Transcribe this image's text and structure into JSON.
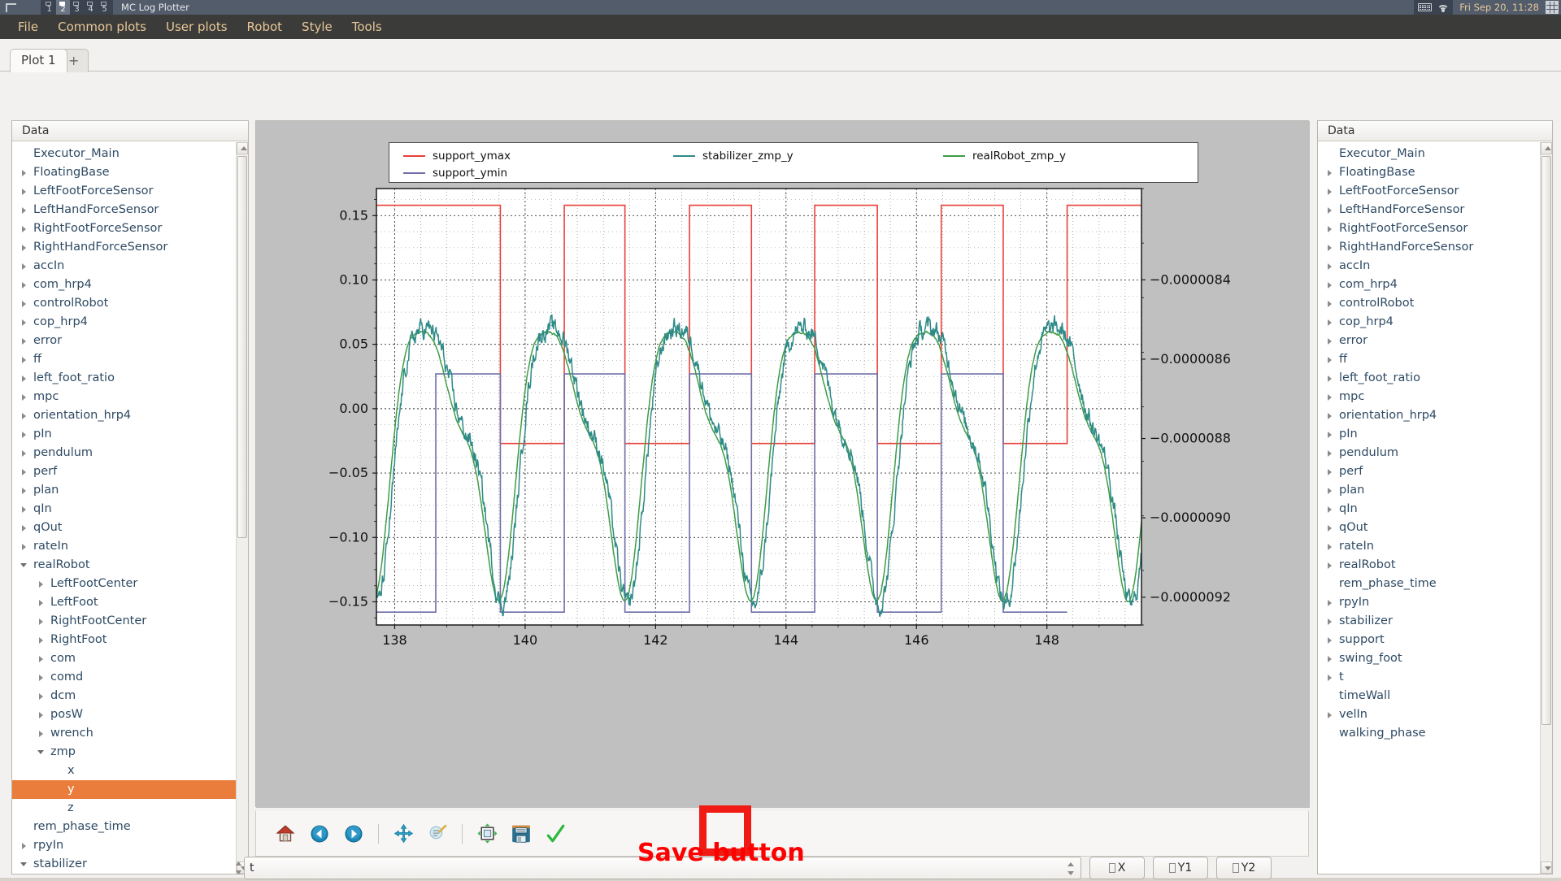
{
  "desktop": {
    "title": "MC Log Plotter",
    "workspaces": [
      "1",
      "2",
      "3",
      "4",
      "5"
    ],
    "active_workspace": "2",
    "clock": "Fri Sep 20, 11:28",
    "tray_icons": [
      "keyboard-icon",
      "wifi-icon",
      "grid-icon"
    ]
  },
  "menubar": {
    "items": [
      "File",
      "Common plots",
      "User plots",
      "Robot",
      "Style",
      "Tools"
    ]
  },
  "tabs": {
    "items": [
      {
        "label": "Plot 1",
        "selected": true
      },
      {
        "label": "+",
        "selected": false
      }
    ]
  },
  "left_panel": {
    "header": "Data",
    "items": [
      {
        "label": "Executor_Main",
        "depth": 0,
        "state": "leaf"
      },
      {
        "label": "FloatingBase",
        "depth": 0,
        "state": "closed"
      },
      {
        "label": "LeftFootForceSensor",
        "depth": 0,
        "state": "closed"
      },
      {
        "label": "LeftHandForceSensor",
        "depth": 0,
        "state": "closed"
      },
      {
        "label": "RightFootForceSensor",
        "depth": 0,
        "state": "closed"
      },
      {
        "label": "RightHandForceSensor",
        "depth": 0,
        "state": "closed"
      },
      {
        "label": "accIn",
        "depth": 0,
        "state": "closed"
      },
      {
        "label": "com_hrp4",
        "depth": 0,
        "state": "closed"
      },
      {
        "label": "controlRobot",
        "depth": 0,
        "state": "closed"
      },
      {
        "label": "cop_hrp4",
        "depth": 0,
        "state": "closed"
      },
      {
        "label": "error",
        "depth": 0,
        "state": "closed"
      },
      {
        "label": "ff",
        "depth": 0,
        "state": "closed"
      },
      {
        "label": "left_foot_ratio",
        "depth": 0,
        "state": "closed"
      },
      {
        "label": "mpc",
        "depth": 0,
        "state": "closed"
      },
      {
        "label": "orientation_hrp4",
        "depth": 0,
        "state": "closed"
      },
      {
        "label": "pIn",
        "depth": 0,
        "state": "closed"
      },
      {
        "label": "pendulum",
        "depth": 0,
        "state": "closed"
      },
      {
        "label": "perf",
        "depth": 0,
        "state": "closed"
      },
      {
        "label": "plan",
        "depth": 0,
        "state": "closed"
      },
      {
        "label": "qIn",
        "depth": 0,
        "state": "closed"
      },
      {
        "label": "qOut",
        "depth": 0,
        "state": "closed"
      },
      {
        "label": "rateIn",
        "depth": 0,
        "state": "closed"
      },
      {
        "label": "realRobot",
        "depth": 0,
        "state": "open"
      },
      {
        "label": "LeftFootCenter",
        "depth": 1,
        "state": "closed"
      },
      {
        "label": "LeftFoot",
        "depth": 1,
        "state": "closed"
      },
      {
        "label": "RightFootCenter",
        "depth": 1,
        "state": "closed"
      },
      {
        "label": "RightFoot",
        "depth": 1,
        "state": "closed"
      },
      {
        "label": "com",
        "depth": 1,
        "state": "closed"
      },
      {
        "label": "comd",
        "depth": 1,
        "state": "closed"
      },
      {
        "label": "dcm",
        "depth": 1,
        "state": "closed"
      },
      {
        "label": "posW",
        "depth": 1,
        "state": "closed"
      },
      {
        "label": "wrench",
        "depth": 1,
        "state": "closed"
      },
      {
        "label": "zmp",
        "depth": 1,
        "state": "open"
      },
      {
        "label": "x",
        "depth": 2,
        "state": "leaf"
      },
      {
        "label": "y",
        "depth": 2,
        "state": "leaf",
        "selected": true
      },
      {
        "label": "z",
        "depth": 2,
        "state": "leaf"
      },
      {
        "label": "rem_phase_time",
        "depth": 0,
        "state": "leaf"
      },
      {
        "label": "rpyIn",
        "depth": 0,
        "state": "closed"
      },
      {
        "label": "stabilizer",
        "depth": 0,
        "state": "open"
      }
    ],
    "selection_color": "#ea7d3c"
  },
  "right_panel": {
    "header": "Data",
    "items": [
      {
        "label": "Executor_Main",
        "state": "leaf"
      },
      {
        "label": "FloatingBase",
        "state": "closed"
      },
      {
        "label": "LeftFootForceSensor",
        "state": "closed"
      },
      {
        "label": "LeftHandForceSensor",
        "state": "closed"
      },
      {
        "label": "RightFootForceSensor",
        "state": "closed"
      },
      {
        "label": "RightHandForceSensor",
        "state": "closed"
      },
      {
        "label": "accIn",
        "state": "closed"
      },
      {
        "label": "com_hrp4",
        "state": "closed"
      },
      {
        "label": "controlRobot",
        "state": "closed"
      },
      {
        "label": "cop_hrp4",
        "state": "closed"
      },
      {
        "label": "error",
        "state": "closed"
      },
      {
        "label": "ff",
        "state": "closed"
      },
      {
        "label": "left_foot_ratio",
        "state": "closed"
      },
      {
        "label": "mpc",
        "state": "closed"
      },
      {
        "label": "orientation_hrp4",
        "state": "closed"
      },
      {
        "label": "pIn",
        "state": "closed"
      },
      {
        "label": "pendulum",
        "state": "closed"
      },
      {
        "label": "perf",
        "state": "closed"
      },
      {
        "label": "plan",
        "state": "closed"
      },
      {
        "label": "qIn",
        "state": "closed"
      },
      {
        "label": "qOut",
        "state": "closed"
      },
      {
        "label": "rateIn",
        "state": "closed"
      },
      {
        "label": "realRobot",
        "state": "closed"
      },
      {
        "label": "rem_phase_time",
        "state": "leaf"
      },
      {
        "label": "rpyIn",
        "state": "closed"
      },
      {
        "label": "stabilizer",
        "state": "closed"
      },
      {
        "label": "support",
        "state": "closed"
      },
      {
        "label": "swing_foot",
        "state": "closed"
      },
      {
        "label": "t",
        "state": "closed"
      },
      {
        "label": "timeWall",
        "state": "leaf"
      },
      {
        "label": "velIn",
        "state": "closed"
      },
      {
        "label": "walking_phase",
        "state": "leaf"
      }
    ]
  },
  "toolbar": {
    "buttons": [
      {
        "name": "home-icon",
        "tip": "Home"
      },
      {
        "name": "back-arrow-icon",
        "tip": "Back"
      },
      {
        "name": "forward-arrow-icon",
        "tip": "Forward"
      },
      {
        "name": "pan-move-icon",
        "tip": "Pan"
      },
      {
        "name": "zoom-rect-icon",
        "tip": "Zoom to rectangle"
      },
      {
        "name": "configure-subplots-icon",
        "tip": "Configure subplots"
      },
      {
        "name": "save-figure-icon",
        "tip": "Save the figure"
      },
      {
        "name": "checkmark-icon",
        "tip": "Apply"
      }
    ]
  },
  "annotation": {
    "text": "Save button",
    "color": "#ff0000",
    "highlight_color": "#ef1b14"
  },
  "bottombar": {
    "expression_value": "t",
    "buttons": [
      {
        "label": "X",
        "glyph": "tofu"
      },
      {
        "label": "Y1",
        "glyph": "tofu"
      },
      {
        "label": "Y2",
        "glyph": "tofu"
      }
    ]
  },
  "chart_data": {
    "type": "line",
    "title": "",
    "xlabel": "",
    "ylabel": "",
    "xlim": [
      137.72,
      149.45
    ],
    "ylim": [
      -0.168,
      0.171
    ],
    "y2lim": [
      -9.27e-06,
      -8.17e-06
    ],
    "xticks": [
      138,
      140,
      142,
      144,
      146,
      148
    ],
    "yticks": [
      0.15,
      0.1,
      0.05,
      0.0,
      -0.05,
      -0.1,
      -0.15
    ],
    "y2ticks": [
      -8.4e-06,
      -8.6e-06,
      -8.8e-06,
      -9e-06,
      -9.2e-06
    ],
    "grid": true,
    "grid_style": "dotted",
    "legend_position": "upper center (outside axes)",
    "legend_ncol": 3,
    "series": [
      {
        "name": "support_ymax",
        "color": "#e8403a",
        "style": "square-wave",
        "high": 0.158,
        "low": -0.027,
        "segments": [
          {
            "x0": 137.72,
            "x1": 139.62,
            "y": 0.158
          },
          {
            "x0": 139.62,
            "x1": 140.6,
            "y": -0.027
          },
          {
            "x0": 140.6,
            "x1": 141.53,
            "y": 0.158
          },
          {
            "x0": 141.53,
            "x1": 142.52,
            "y": -0.027
          },
          {
            "x0": 142.52,
            "x1": 143.47,
            "y": 0.158
          },
          {
            "x0": 143.47,
            "x1": 144.44,
            "y": -0.027
          },
          {
            "x0": 144.44,
            "x1": 145.4,
            "y": 0.158
          },
          {
            "x0": 145.4,
            "x1": 146.38,
            "y": -0.027
          },
          {
            "x0": 146.38,
            "x1": 147.33,
            "y": 0.158
          },
          {
            "x0": 147.33,
            "x1": 148.31,
            "y": -0.027
          },
          {
            "x0": 148.31,
            "x1": 149.45,
            "y": 0.158
          }
        ]
      },
      {
        "name": "support_ymin",
        "color": "#6e6ea8",
        "style": "square-wave",
        "high": 0.027,
        "low": -0.158,
        "segments": [
          {
            "x0": 137.72,
            "x1": 138.63,
            "y": -0.158
          },
          {
            "x0": 138.63,
            "x1": 139.62,
            "y": 0.027
          },
          {
            "x0": 139.62,
            "x1": 140.6,
            "y": -0.158
          },
          {
            "x0": 140.6,
            "x1": 141.53,
            "y": 0.027
          },
          {
            "x0": 141.53,
            "x1": 142.52,
            "y": -0.158
          },
          {
            "x0": 142.52,
            "x1": 143.47,
            "y": 0.027
          },
          {
            "x0": 143.47,
            "x1": 144.44,
            "y": -0.158
          },
          {
            "x0": 144.44,
            "x1": 145.4,
            "y": 0.027
          },
          {
            "x0": 145.4,
            "x1": 146.38,
            "y": -0.158
          },
          {
            "x0": 146.38,
            "x1": 147.33,
            "y": 0.027
          },
          {
            "x0": 147.33,
            "x1": 148.31,
            "y": -0.158
          }
        ]
      },
      {
        "name": "stabilizer_zmp_y",
        "color": "#2e8b87",
        "style": "noisy-oscillation",
        "period": 1.93,
        "amplitude": 0.095,
        "phase": 138.1,
        "noise": 0.006,
        "peak_high": 0.085,
        "peak_low": -0.128
      },
      {
        "name": "realRobot_zmp_y",
        "color": "#3f9c45",
        "style": "smooth-oscillation",
        "period": 1.93,
        "amplitude": 0.092,
        "phase": 138.05,
        "noise": 0.002,
        "peak_high": 0.078,
        "peak_low": -0.125
      }
    ]
  }
}
